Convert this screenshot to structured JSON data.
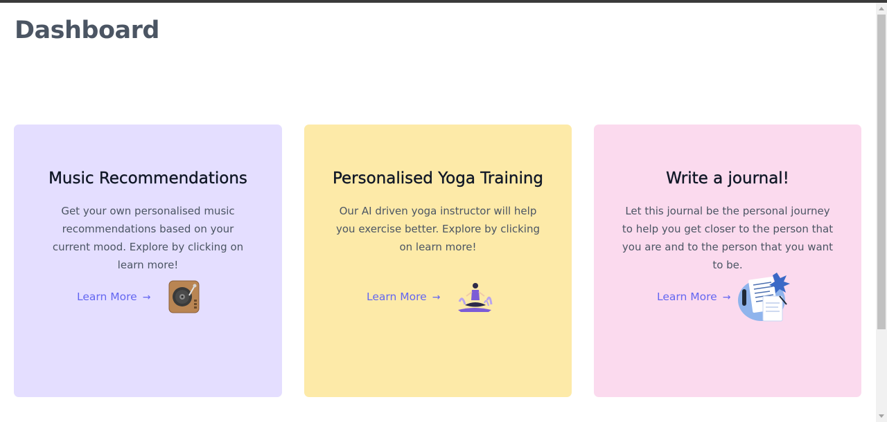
{
  "page": {
    "title": "Dashboard"
  },
  "cards": [
    {
      "title": "Music Recommendations",
      "description": "Get your own personalised music recommendations based on your current mood. Explore by clicking on learn more!",
      "link_label": "Learn More",
      "arrow": "→",
      "icon": "turntable-icon",
      "background": "#e4deff"
    },
    {
      "title": "Personalised Yoga Training",
      "description": "Our AI driven yoga instructor will help you exercise better. Explore by clicking on learn more!",
      "link_label": "Learn More",
      "arrow": "→",
      "icon": "yoga-meditation-icon",
      "background": "#fdeaa8"
    },
    {
      "title": "Write a journal!",
      "description": "Let this journal be the personal journey to help you get closer to the person that you are and to the person that you want to be.",
      "link_label": "Learn More",
      "arrow": "→",
      "icon": "journal-writing-icon",
      "background": "#fbdaee"
    }
  ],
  "colors": {
    "link": "#6366f1",
    "heading": "#4b5563"
  }
}
